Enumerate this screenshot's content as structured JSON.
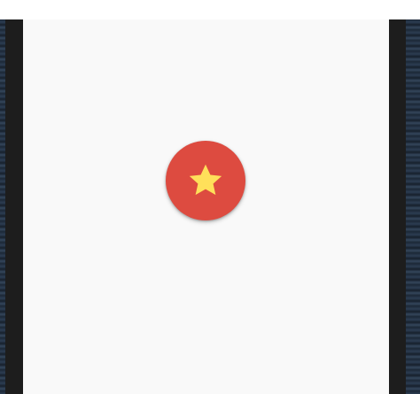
{
  "colors": {
    "screen_background": "#f9f9f9",
    "fab_background": "#dd4b40",
    "star_color": "#ffe05a",
    "frame": "#1d1d1d"
  },
  "fab": {
    "icon": "star-icon"
  }
}
